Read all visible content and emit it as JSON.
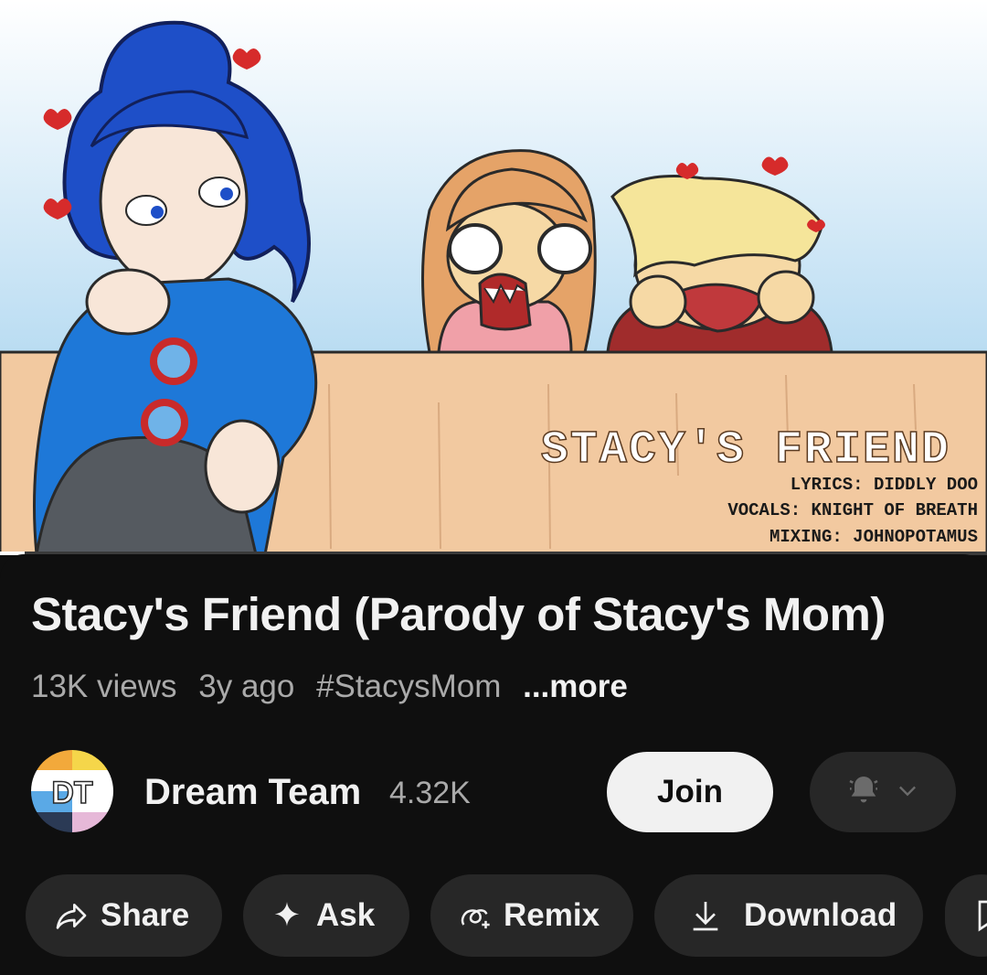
{
  "thumbnail": {
    "overlay_title": "STACY'S FRIEND",
    "credit_lines": [
      "LYRICS: DIDDLY DOO",
      "VOCALS: KNIGHT OF BREATH",
      "MIXING: JOHNOPOTAMUS"
    ],
    "progress_fraction": 0.025
  },
  "video": {
    "title": "Stacy's Friend (Parody of Stacy's Mom)",
    "views": "13K views",
    "age": "3y ago",
    "hashtag": "#StacysMom",
    "more": "...more"
  },
  "channel": {
    "avatar_text": "DT",
    "name": "Dream Team",
    "subscribers": "4.32K",
    "join_label": "Join",
    "bell_icon": "bell-icon",
    "dropdown_icon": "chevron-down-icon"
  },
  "actions": [
    {
      "label": "Share",
      "icon": "share-icon"
    },
    {
      "label": "Ask",
      "icon": "sparkle-icon"
    },
    {
      "label": "Remix",
      "icon": "remix-icon"
    },
    {
      "label": "Download",
      "icon": "download-icon"
    },
    {
      "label": "",
      "icon": "save-icon"
    }
  ],
  "colors": {
    "background": "#0f0f0f",
    "chip": "#272727",
    "text_primary": "#f1f1f1",
    "text_secondary": "#aaaaaa",
    "join_bg": "#f1f1f1"
  }
}
